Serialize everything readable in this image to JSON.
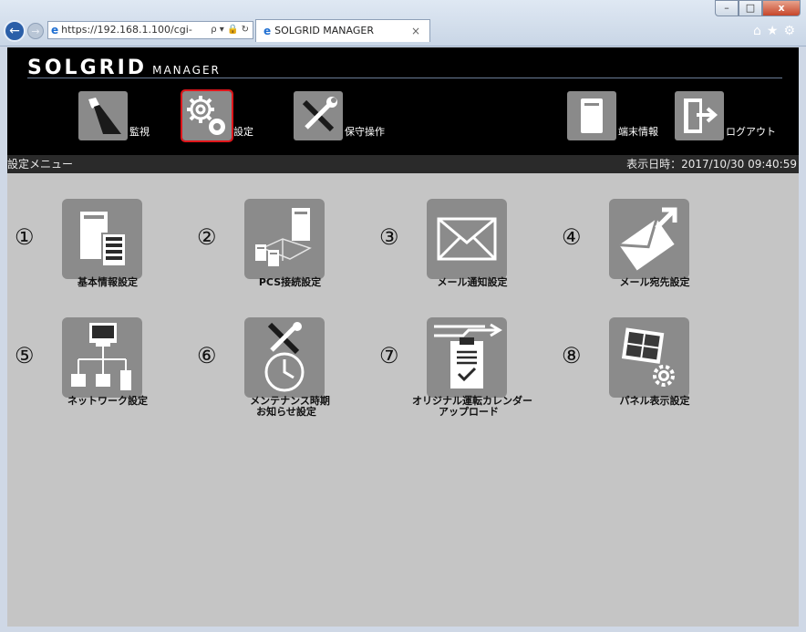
{
  "browser": {
    "url": "https://192.168.1.100/cgi-",
    "address_tools": "ρ ▾ 🔒 ↻",
    "tab_title": "SOLGRID MANAGER",
    "tab_close": "×",
    "win_min": "–",
    "win_max": "□",
    "win_close": "x",
    "right_icons": "⌂★⚙"
  },
  "app": {
    "logo_main": "SOLGRID",
    "logo_sub": "MANAGER"
  },
  "topnav": [
    {
      "label": "監視",
      "icon": "flashlight-icon"
    },
    {
      "label": "設定",
      "icon": "gear-icon"
    },
    {
      "label": "保守操作",
      "icon": "tools-icon"
    },
    {
      "label": "端末情報",
      "icon": "terminal-icon"
    },
    {
      "label": "ログアウト",
      "icon": "logout-icon"
    }
  ],
  "subbar": {
    "title": "設定メニュー",
    "datetime_label": "表示日時：2017/10/30 09:40:59"
  },
  "menu": [
    {
      "num": "①",
      "line1": "基本情報設定",
      "line2": "",
      "icon": "cabinet-list-icon"
    },
    {
      "num": "②",
      "line1": "PCS接続設定",
      "line2": "",
      "icon": "pcs-connection-icon"
    },
    {
      "num": "③",
      "line1": "メール通知設定",
      "line2": "",
      "icon": "envelope-icon"
    },
    {
      "num": "④",
      "line1": "メール宛先設定",
      "line2": "",
      "icon": "send-mail-icon"
    },
    {
      "num": "⑤",
      "line1": "ネットワーク設定",
      "line2": "",
      "icon": "network-icon"
    },
    {
      "num": "⑥",
      "line1": "メンテナンス時期",
      "line2": "お知らせ設定",
      "icon": "maintenance-clock-icon"
    },
    {
      "num": "⑦",
      "line1": "オリジナル運転カレンダー",
      "line2": "アップロード",
      "icon": "calendar-upload-icon"
    },
    {
      "num": "⑧",
      "line1": "パネル表示設定",
      "line2": "",
      "icon": "panel-gear-icon"
    }
  ]
}
